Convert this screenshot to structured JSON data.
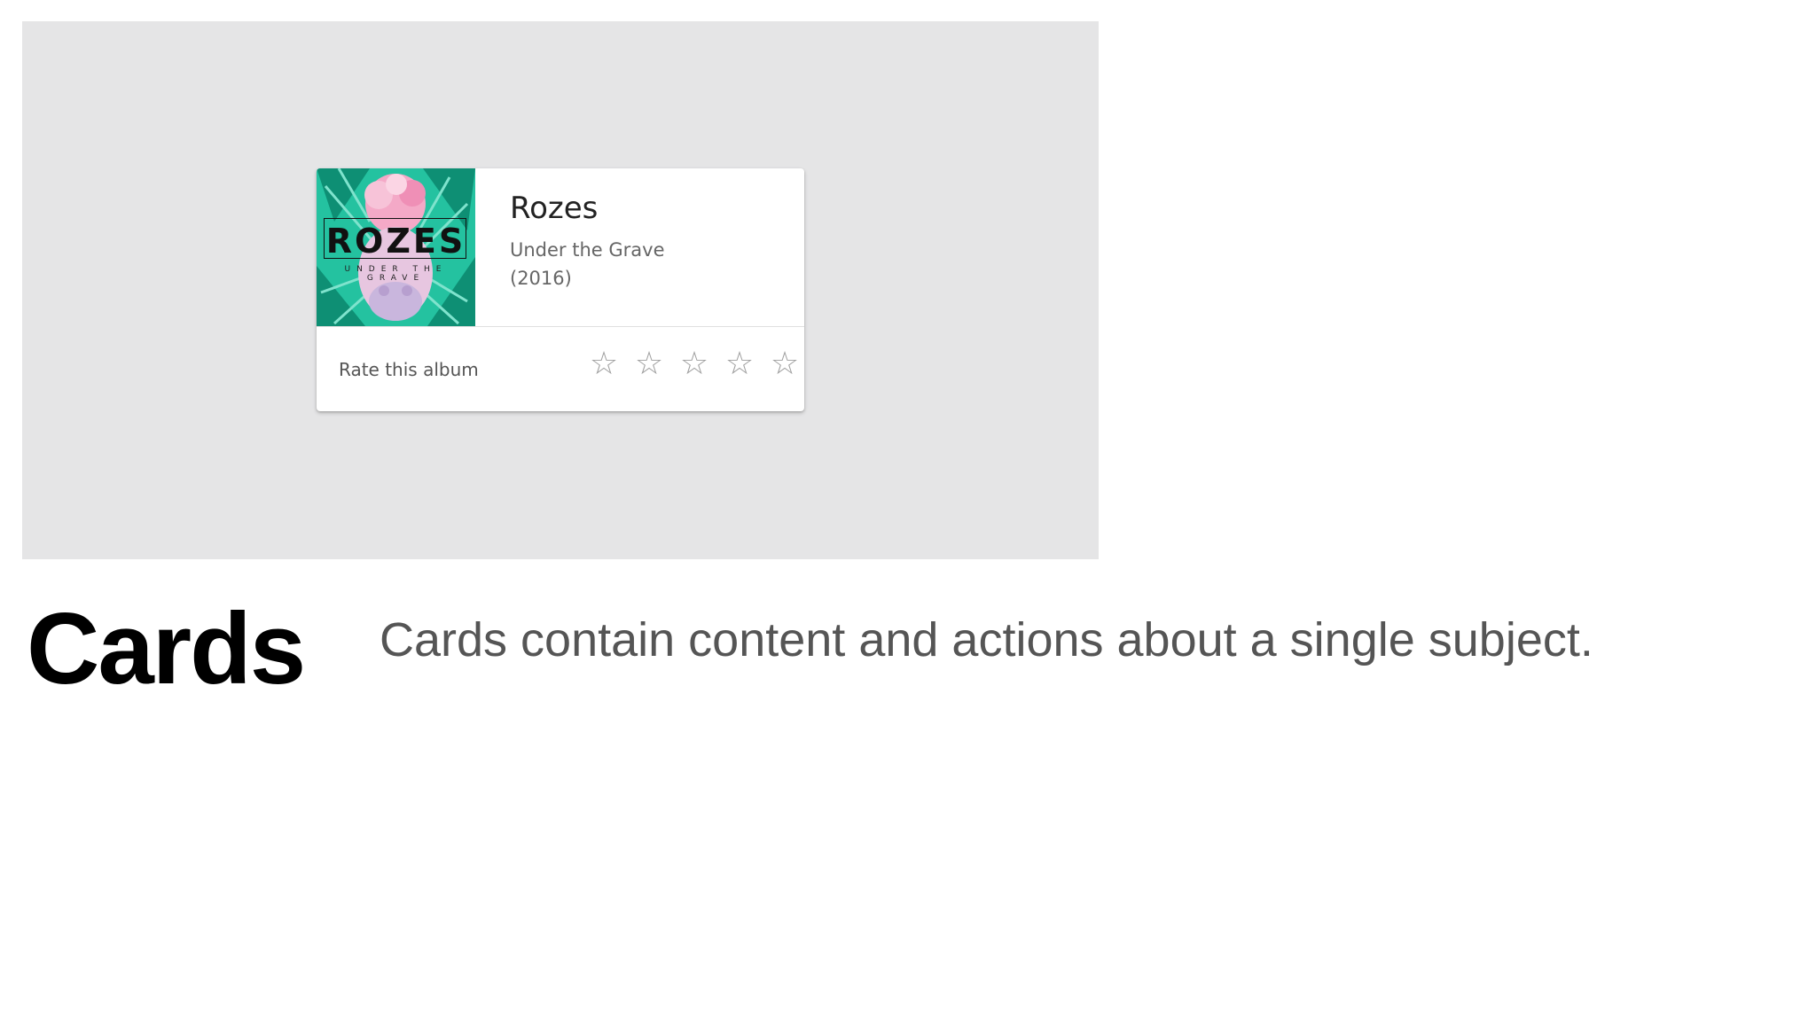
{
  "slide": {
    "heading": "Cards",
    "description": "Cards contain content and actions about a single subject."
  },
  "card": {
    "album_art": {
      "title": "ROZES",
      "subtitle": "UNDER THE GRAVE"
    },
    "artist": "Rozes",
    "album": "Under the Grave",
    "year": "(2016)",
    "rate_label": "Rate this album",
    "rating": {
      "value": 0,
      "max": 5
    },
    "star_glyph": "☆"
  },
  "colors": {
    "panel_background": "#e5e5e6",
    "star": "#9e9e9e",
    "art_teal": "#1fbf9f",
    "art_pink": "#f2a6c6"
  }
}
